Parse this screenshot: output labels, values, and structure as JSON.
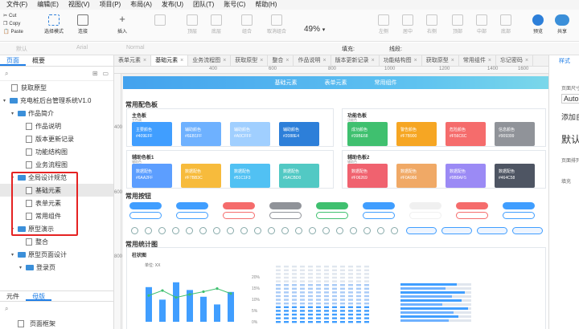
{
  "menu": [
    "文件(F)",
    "编辑(E)",
    "视图(V)",
    "项目(P)",
    "布局(A)",
    "发布(U)",
    "团队(T)",
    "账号(C)",
    "帮助(H)"
  ],
  "clipboard": [
    "Cut",
    "Copy",
    "Paste"
  ],
  "toolbar": {
    "select": "选择模式",
    "connect": "连接",
    "insert": "插入",
    "zoom": "49%",
    "preview": "预览",
    "share": "共享",
    "items": [
      "顶层",
      "底层",
      "组合",
      "取消组合",
      "左侧",
      "居中",
      "右侧",
      "顶部",
      "中部",
      "底部"
    ]
  },
  "format": {
    "default": "默认",
    "font": "Arial",
    "style": "Normal",
    "fill": "填充:",
    "line": "线段:"
  },
  "left": {
    "tab_pages": "页面",
    "tab_outline": "概要",
    "tree": [
      {
        "label": "获取原型",
        "level": 0,
        "type": "page"
      },
      {
        "label": "充电桩后台管理系统V1.0",
        "level": 0,
        "type": "folder"
      },
      {
        "label": "作品简介",
        "level": 1,
        "type": "folder"
      },
      {
        "label": "作品说明",
        "level": 2,
        "type": "page"
      },
      {
        "label": "版本更新记录",
        "level": 2,
        "type": "page"
      },
      {
        "label": "功能结构图",
        "level": 2,
        "type": "page"
      },
      {
        "label": "业务流程图",
        "level": 2,
        "type": "page"
      },
      {
        "label": "全局设计规范",
        "level": 1,
        "type": "folder"
      },
      {
        "label": "基础元素",
        "level": 2,
        "type": "page",
        "selected": true
      },
      {
        "label": "表单元素",
        "level": 2,
        "type": "page"
      },
      {
        "label": "常用组件",
        "level": 2,
        "type": "page"
      },
      {
        "label": "原型演示",
        "level": 1,
        "type": "folder"
      },
      {
        "label": "整合",
        "level": 2,
        "type": "page"
      },
      {
        "label": "原型页面设计",
        "level": 1,
        "type": "folder"
      },
      {
        "label": "登录页",
        "level": 2,
        "type": "folder"
      }
    ],
    "tab_components": "元件",
    "tab_masters": "母版",
    "bottom_item": "页面框架"
  },
  "tabs": [
    {
      "label": "表单元素",
      "active": false
    },
    {
      "label": "基础元素",
      "active": true
    },
    {
      "label": "业务流程图",
      "active": false
    },
    {
      "label": "获取原型",
      "active": false
    },
    {
      "label": "整合",
      "active": false
    },
    {
      "label": "作品说明",
      "active": false
    },
    {
      "label": "版本更新记录",
      "active": false
    },
    {
      "label": "功能结构图",
      "active": false
    },
    {
      "label": "获取原型",
      "active": false
    },
    {
      "label": "常用组件",
      "active": false
    },
    {
      "label": "忘记密码",
      "active": false
    }
  ],
  "rulers": {
    "h": [
      "400",
      "600",
      "800",
      "1000",
      "1200",
      "1400",
      "1600"
    ],
    "v": [
      "400",
      "600",
      "800"
    ]
  },
  "page": {
    "banner": [
      "基础元素",
      "表单元素",
      "常用组件"
    ],
    "sec_color": "常用配色板",
    "sec_btn": "常用按钮",
    "sec_chart": "常用统计图",
    "card_main": {
      "title": "主色板",
      "sub": "主色调"
    },
    "card_func": {
      "title": "功能色板",
      "sub": "功能色"
    },
    "card_aux1": {
      "title": "辅助色板1",
      "sub": "辅助色"
    },
    "card_aux2": {
      "title": "辅助色板2",
      "sub": "辅助色"
    },
    "sw_main": [
      {
        "name": "主要颜色",
        "hex": "#409EFF",
        "color": "#409eff"
      },
      {
        "name": "辅助颜色",
        "hex": "#6EB1FF",
        "color": "#6eb1ff"
      },
      {
        "name": "辅助颜色",
        "hex": "#A0CFFF",
        "color": "#a0cfff"
      },
      {
        "name": "辅助颜色",
        "hex": "#2088E4",
        "color": "#2d7fd9"
      }
    ],
    "sw_func": [
      {
        "name": "成功颜色",
        "hex": "#39BE68",
        "color": "#3fc06f"
      },
      {
        "name": "警告颜色",
        "hex": "#F7B900",
        "color": "#f6a623"
      },
      {
        "name": "危险颜色",
        "hex": "#F56C6C",
        "color": "#f56c6c"
      },
      {
        "name": "信息颜色",
        "hex": "#909399",
        "color": "#909399"
      }
    ],
    "sw_aux1": [
      {
        "name": "数据配色",
        "hex": "#6AA2FF",
        "color": "#5c9eff"
      },
      {
        "name": "数据配色",
        "hex": "#F7BB3C",
        "color": "#f7bb3c"
      },
      {
        "name": "数据配色",
        "hex": "#51C1F3",
        "color": "#51c1f3"
      },
      {
        "name": "数据配色",
        "hex": "#5ACBD0",
        "color": "#52c9c4"
      }
    ],
    "sw_aux2": [
      {
        "name": "数据配色",
        "hex": "#F06269",
        "color": "#f0626f"
      },
      {
        "name": "数据配色",
        "hex": "#F0A966",
        "color": "#f0a966"
      },
      {
        "name": "数据配色",
        "hex": "#9B8AF5",
        "color": "#9b8af5"
      },
      {
        "name": "数据配色",
        "hex": "#464C58",
        "color": "#4e5563"
      }
    ],
    "chart_title": "柱状图",
    "chart_unit": "单位: XX",
    "pct": [
      "20%",
      "15%",
      "10%",
      "5%",
      "0%"
    ]
  },
  "right": {
    "tab": "样式",
    "l1": "页面尺寸",
    "auto": "Auto",
    "l2": "添加自适",
    "def": "默认",
    "l3": "页面排列",
    "fill": "填充"
  }
}
